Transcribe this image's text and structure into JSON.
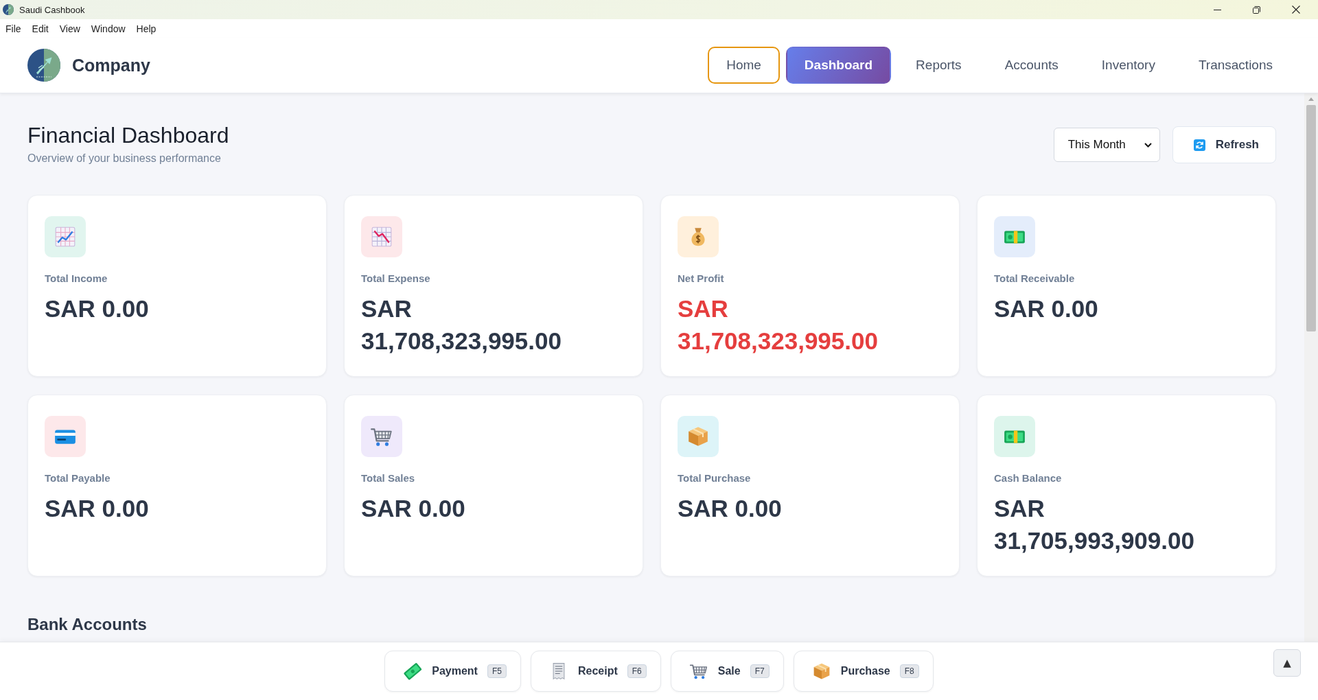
{
  "window": {
    "title": "Saudi Cashbook"
  },
  "menu": [
    "File",
    "Edit",
    "View",
    "Window",
    "Help"
  ],
  "header": {
    "company": "Company",
    "nav": [
      {
        "label": "Home",
        "selected": false,
        "focused": true
      },
      {
        "label": "Dashboard",
        "selected": true,
        "focused": false
      },
      {
        "label": "Reports",
        "selected": false,
        "focused": false
      },
      {
        "label": "Accounts",
        "selected": false,
        "focused": false
      },
      {
        "label": "Inventory",
        "selected": false,
        "focused": false
      },
      {
        "label": "Transactions",
        "selected": false,
        "focused": false
      }
    ]
  },
  "page": {
    "title": "Financial Dashboard",
    "subtitle": "Overview of your business performance",
    "period": {
      "value": "This Month"
    },
    "refresh": {
      "label": "Refresh"
    }
  },
  "cards": [
    {
      "label": "Total Income",
      "value": "SAR 0.00",
      "negative": false,
      "color": "#e1f5ef"
    },
    {
      "label": "Total Expense",
      "value": "SAR 31,708,323,995.00",
      "negative": false,
      "color": "#fde8ea"
    },
    {
      "label": "Net Profit",
      "value": "SAR 31,708,323,995.00",
      "negative": true,
      "color": "#fff0dc"
    },
    {
      "label": "Total Receivable",
      "value": "SAR 0.00",
      "negative": false,
      "color": "#e4edfb"
    },
    {
      "label": "Total Payable",
      "value": "SAR 0.00",
      "negative": false,
      "color": "#fde8ea"
    },
    {
      "label": "Total Sales",
      "value": "SAR 0.00",
      "negative": false,
      "color": "#efe9fb"
    },
    {
      "label": "Total Purchase",
      "value": "SAR 0.00",
      "negative": false,
      "color": "#ddf4f8"
    },
    {
      "label": "Cash Balance",
      "value": "SAR 31,705,993,909.00",
      "negative": false,
      "color": "#ddf5ec"
    }
  ],
  "bank_accounts": {
    "title": "Bank Accounts"
  },
  "quick_actions": [
    {
      "label": "Payment",
      "shortcut": "F5"
    },
    {
      "label": "Receipt",
      "shortcut": "F6"
    },
    {
      "label": "Sale",
      "shortcut": "F7"
    },
    {
      "label": "Purchase",
      "shortcut": "F8"
    }
  ],
  "scroll_top": {
    "label": "▲"
  }
}
